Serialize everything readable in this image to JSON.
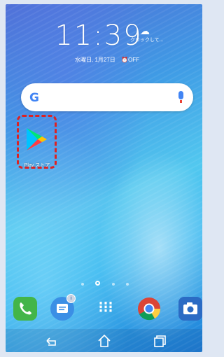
{
  "status": {
    "time": "11:39",
    "weather_text": "クリックして...",
    "weather_icon": "cloud-icon",
    "date": "水曜日, 1月27日",
    "alarm": "OFF"
  },
  "search": {
    "logo": "G",
    "mic_icon": "mic-icon"
  },
  "home_apps": [
    {
      "label": "Play ストア",
      "icon": "google-play-icon"
    }
  ],
  "page_indicator": {
    "count": 4,
    "current": 2
  },
  "dock": [
    {
      "name": "phone",
      "icon": "phone-icon"
    },
    {
      "name": "messages",
      "icon": "message-icon",
      "badge": "i"
    },
    {
      "name": "all-apps",
      "icon": "apps-grid-icon"
    },
    {
      "name": "chrome",
      "icon": "chrome-icon"
    },
    {
      "name": "camera",
      "icon": "camera-icon"
    }
  ],
  "navbar": [
    {
      "name": "back",
      "icon": "back-icon"
    },
    {
      "name": "home",
      "icon": "home-icon"
    },
    {
      "name": "recents",
      "icon": "recents-icon"
    }
  ]
}
